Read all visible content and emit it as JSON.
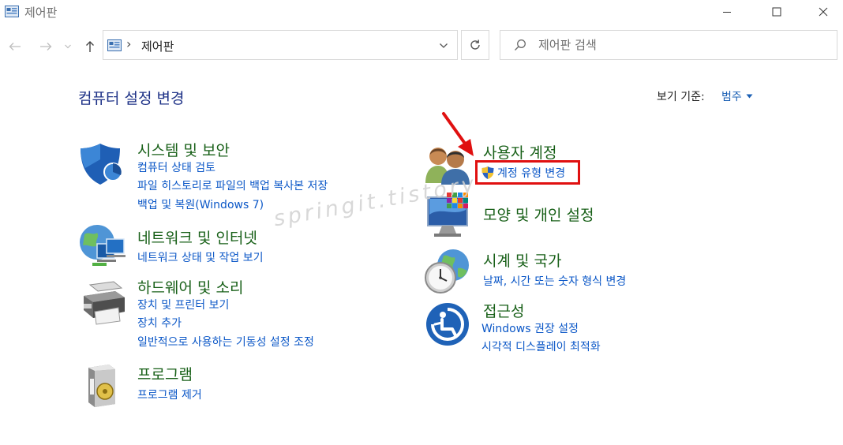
{
  "window": {
    "title": "제어판"
  },
  "address": {
    "path": "제어판",
    "separator": "›"
  },
  "search": {
    "placeholder": "제어판 검색"
  },
  "main": {
    "title": "컴퓨터 설정 변경",
    "view_by_label": "보기 기준:",
    "view_by_value": "범주"
  },
  "categories": [
    {
      "title": "시스템 및 보안",
      "links": [
        "컴퓨터 상태 검토",
        "파일 히스토리로 파일의 백업 복사본 저장",
        "백업 및 복원(Windows 7)"
      ],
      "icon": "shield-icon"
    },
    {
      "title": "네트워크 및 인터넷",
      "links": [
        "네트워크 상태 및 작업 보기"
      ],
      "icon": "network-icon"
    },
    {
      "title": "하드웨어 및 소리",
      "links": [
        "장치 및 프린터 보기",
        "장치 추가",
        "일반적으로 사용하는 기동성 설정 조정"
      ],
      "icon": "printer-icon"
    },
    {
      "title": "프로그램",
      "links": [
        "프로그램 제거"
      ],
      "icon": "programs-icon"
    },
    {
      "title": "사용자 계정",
      "links": [
        "계정 유형 변경"
      ],
      "icon": "users-icon"
    },
    {
      "title": "모양 및 개인 설정",
      "links": [],
      "icon": "monitor-icon"
    },
    {
      "title": "시계 및 국가",
      "links": [
        "날짜, 시간 또는 숫자 형식 변경"
      ],
      "icon": "clock-globe-icon"
    },
    {
      "title": "접근성",
      "links": [
        "Windows 권장 설정",
        "시각적 디스플레이 최적화"
      ],
      "icon": "accessibility-icon"
    }
  ],
  "annotation": {
    "watermark": "springit.tistory",
    "highlight_color": "#e01010"
  },
  "colors": {
    "category_title": "#186018",
    "link": "#0b57c7",
    "page_title": "#1e3287"
  }
}
